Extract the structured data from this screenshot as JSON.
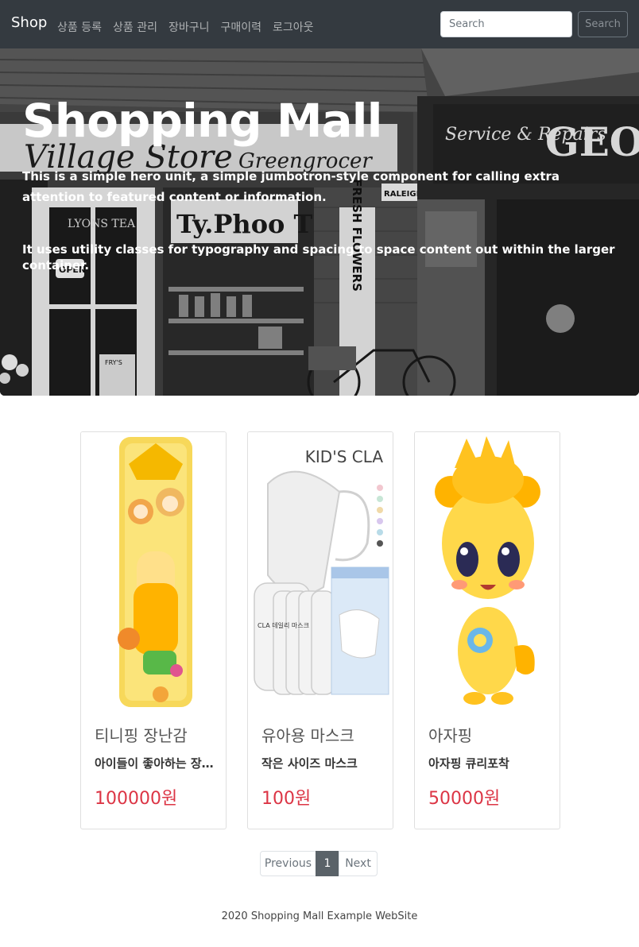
{
  "navbar": {
    "brand": "Shop",
    "links": [
      "상품 등록",
      "상품 관리",
      "장바구니",
      "구매이력",
      "로그아웃"
    ],
    "search_placeholder": "Search",
    "search_button": "Search"
  },
  "hero": {
    "title": "Shopping Mall",
    "lead": "This is a simple hero unit, a simple jumbotron-style component for calling extra attention to featured content or information.",
    "sub": "It uses utility classes for typography and spacing to space content out within the larger container.",
    "background_signs": [
      "Village Store",
      "Greengrocer",
      "Service & Repairs",
      "GEO",
      "LYONS TEA",
      "OPEN",
      "Ty.Phoo TEA",
      "FRESH FLOWERS",
      "RALEIGH",
      "FRY'S"
    ]
  },
  "products": [
    {
      "name": "티니핑 장난감",
      "desc": "아이들이 좋아하는 장난감",
      "price": "100000원",
      "image": "tinyping-toy-box"
    },
    {
      "name": "유아용 마스크",
      "desc": "작은 사이즈 마스크",
      "price": "100원",
      "image": "kids-cla-mask",
      "image_text": [
        "KID'S CLA",
        "CLA 데일리 마스크"
      ]
    },
    {
      "name": "아자핑",
      "desc": "아자핑 큐리포착",
      "price": "50000원",
      "image": "ajaping-character"
    }
  ],
  "pagination": {
    "previous": "Previous",
    "current": "1",
    "next": "Next"
  },
  "footer": "2020 Shopping Mall Example WebSite",
  "colors": {
    "navbar": "#343a40",
    "price": "#dc3545",
    "active_page": "#5a6268"
  }
}
